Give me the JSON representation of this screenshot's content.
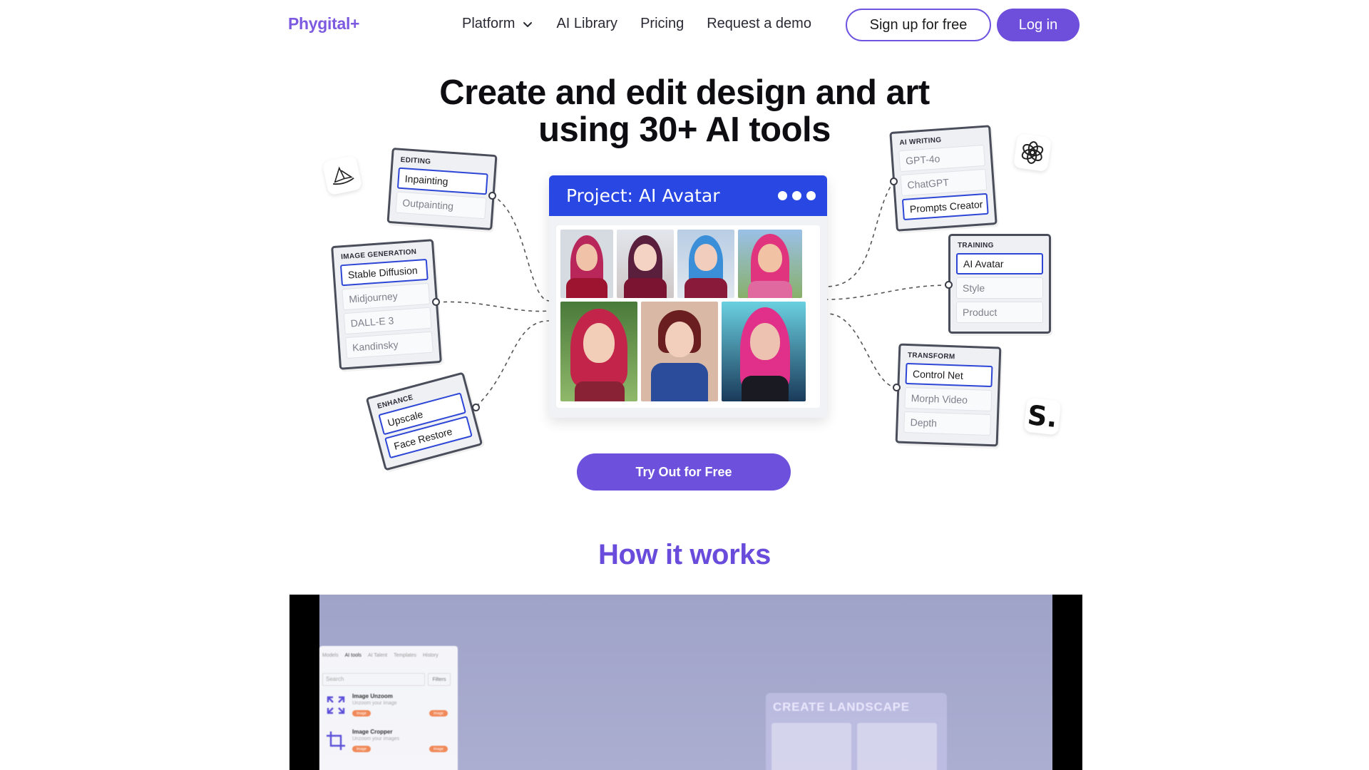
{
  "nav": {
    "logo": "Phygital+",
    "links": [
      {
        "label": "Platform"
      },
      {
        "label": "AI Library"
      },
      {
        "label": "Pricing"
      },
      {
        "label": "Request a demo"
      }
    ],
    "signup": "Sign up for free",
    "login": "Log in"
  },
  "hero": {
    "title_line1": "Create and edit design and art",
    "title_line2": "using 30+ AI tools",
    "cta": "Try Out for Free"
  },
  "cards": {
    "editing": {
      "title": "EDITING",
      "items": [
        "Inpainting",
        "Outpainting"
      ]
    },
    "image_generation": {
      "title": "IMAGE GENERATION",
      "items": [
        "Stable Diffusion",
        "Midjourney",
        "DALL-E 3",
        "Kandinsky"
      ]
    },
    "enhance": {
      "title": "ENHANCE",
      "items": [
        "Upscale",
        "Face Restore"
      ]
    },
    "ai_writing": {
      "title": "AI WRITING",
      "items": [
        "GPT-4o",
        "ChatGPT",
        "Prompts Creator"
      ]
    },
    "training": {
      "title": "TRAINING",
      "items": [
        "AI Avatar",
        "Style",
        "Product"
      ]
    },
    "transform": {
      "title": "TRANSFORM",
      "items": [
        "Control Net",
        "Morph Video",
        "Depth"
      ]
    }
  },
  "brands": {
    "left_icon": "midjourney-sailboat-icon",
    "right_icon": "openai-logo-icon",
    "stability_text": "S."
  },
  "project": {
    "title": "Project: AI Avatar"
  },
  "section": {
    "how_title": "How it works"
  },
  "video": {
    "tabs": [
      "Models",
      "AI tools",
      "AI Talent",
      "Templates",
      "History"
    ],
    "search_placeholder": "Search",
    "filters": "Filters",
    "rows": [
      {
        "name": "Image Unzoom",
        "sub": "Unzoom your image",
        "tag": "Image"
      },
      {
        "name": "Image Cropper",
        "sub": "Unzoom your images",
        "tag": "Image"
      }
    ],
    "landscape_title": "CREATE LANDSCAPE"
  },
  "colors": {
    "brand_purple": "#6e4fdc",
    "project_blue": "#2947e3",
    "selected_border": "#2d46d6"
  }
}
